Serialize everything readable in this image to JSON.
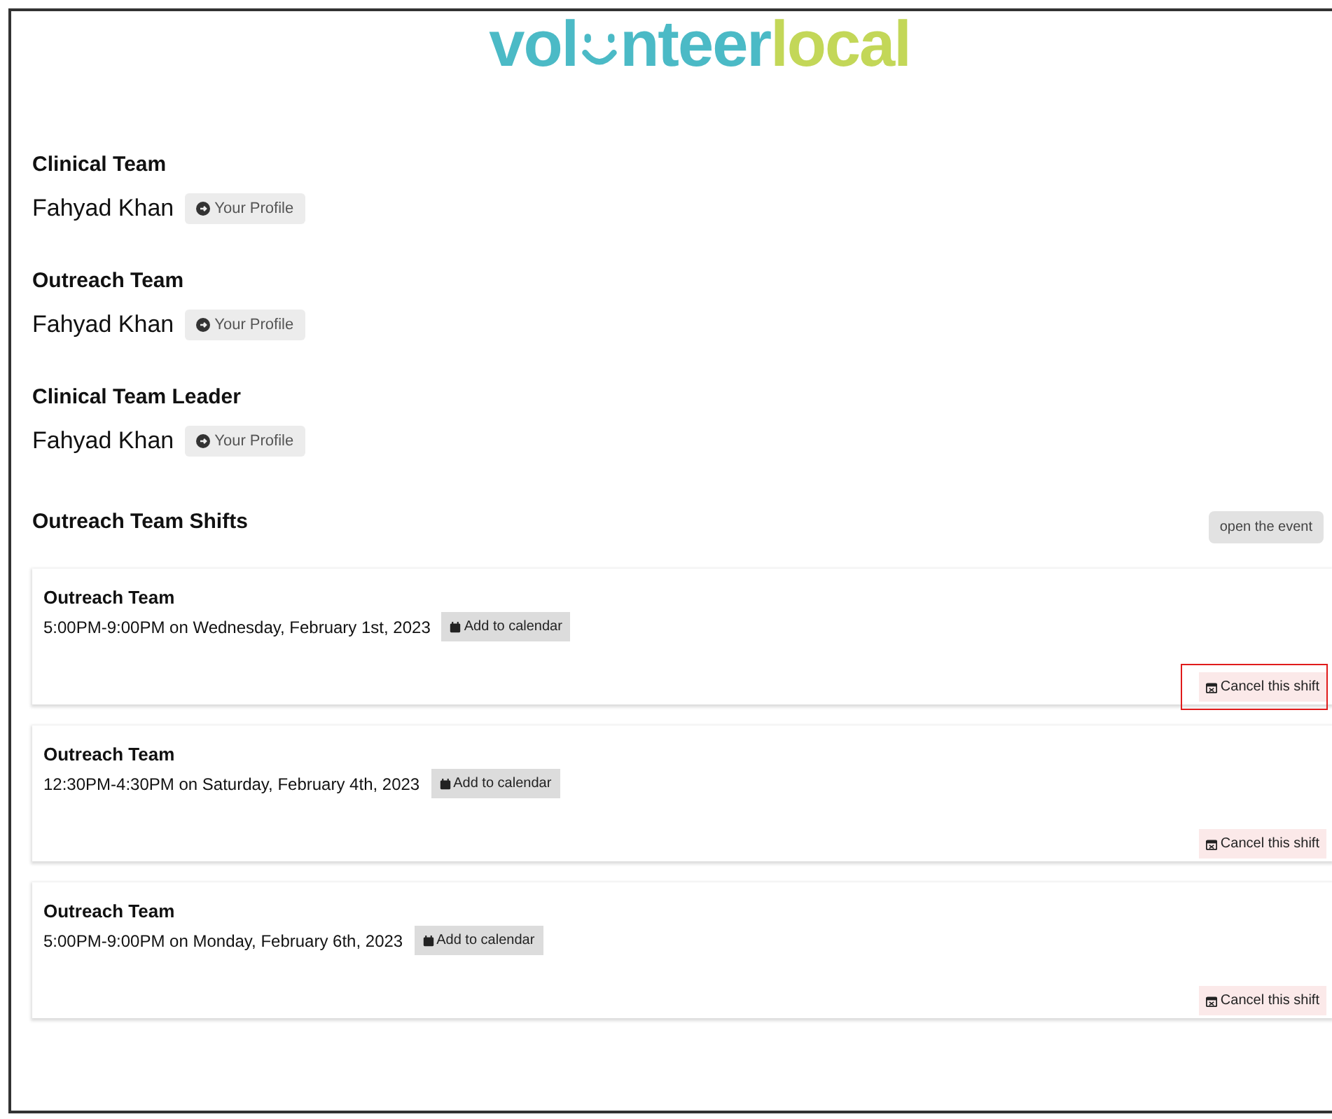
{
  "logo": {
    "part_1": "vol",
    "part_2": "nteer",
    "part_3": "local"
  },
  "roles": [
    {
      "heading": "Clinical Team",
      "name": "Fahyad Khan",
      "button": "Your Profile"
    },
    {
      "heading": "Outreach Team",
      "name": "Fahyad Khan",
      "button": "Your Profile"
    },
    {
      "heading": "Clinical Team Leader",
      "name": "Fahyad Khan",
      "button": "Your Profile"
    }
  ],
  "shifts_section": {
    "heading": "Outreach Team Shifts",
    "open_button": "open the event"
  },
  "shifts": [
    {
      "title": "Outreach Team",
      "time": "5:00PM-9:00PM on Wednesday, February 1st, 2023",
      "add_button": "Add to calendar",
      "cancel_button": "Cancel this shift",
      "highlighted": true
    },
    {
      "title": "Outreach Team",
      "time": "12:30PM-4:30PM on Saturday, February 4th, 2023",
      "add_button": "Add to calendar",
      "cancel_button": "Cancel this shift",
      "highlighted": false
    },
    {
      "title": "Outreach Team",
      "time": "5:00PM-9:00PM on Monday, February 6th, 2023",
      "add_button": "Add to calendar",
      "cancel_button": "Cancel this shift",
      "highlighted": false
    }
  ]
}
